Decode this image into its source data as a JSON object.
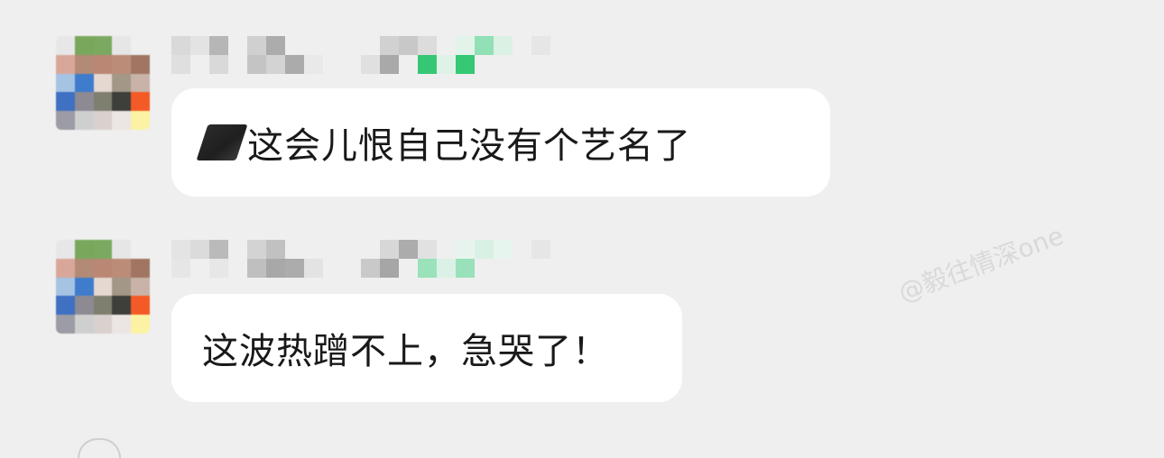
{
  "messages": [
    {
      "sender_name": "",
      "text_visible": "这会儿恨自己没有个艺名了",
      "text_partially_redacted_prefix": true
    },
    {
      "sender_name": "",
      "text_visible": "这波热蹭不上，急哭了！",
      "text_partially_redacted_prefix": false
    }
  ],
  "watermark": "@毅往情深one",
  "colors": {
    "background": "#efefef",
    "bubble": "#ffffff",
    "text": "#191919",
    "redaction_green": "#2dc56e"
  }
}
